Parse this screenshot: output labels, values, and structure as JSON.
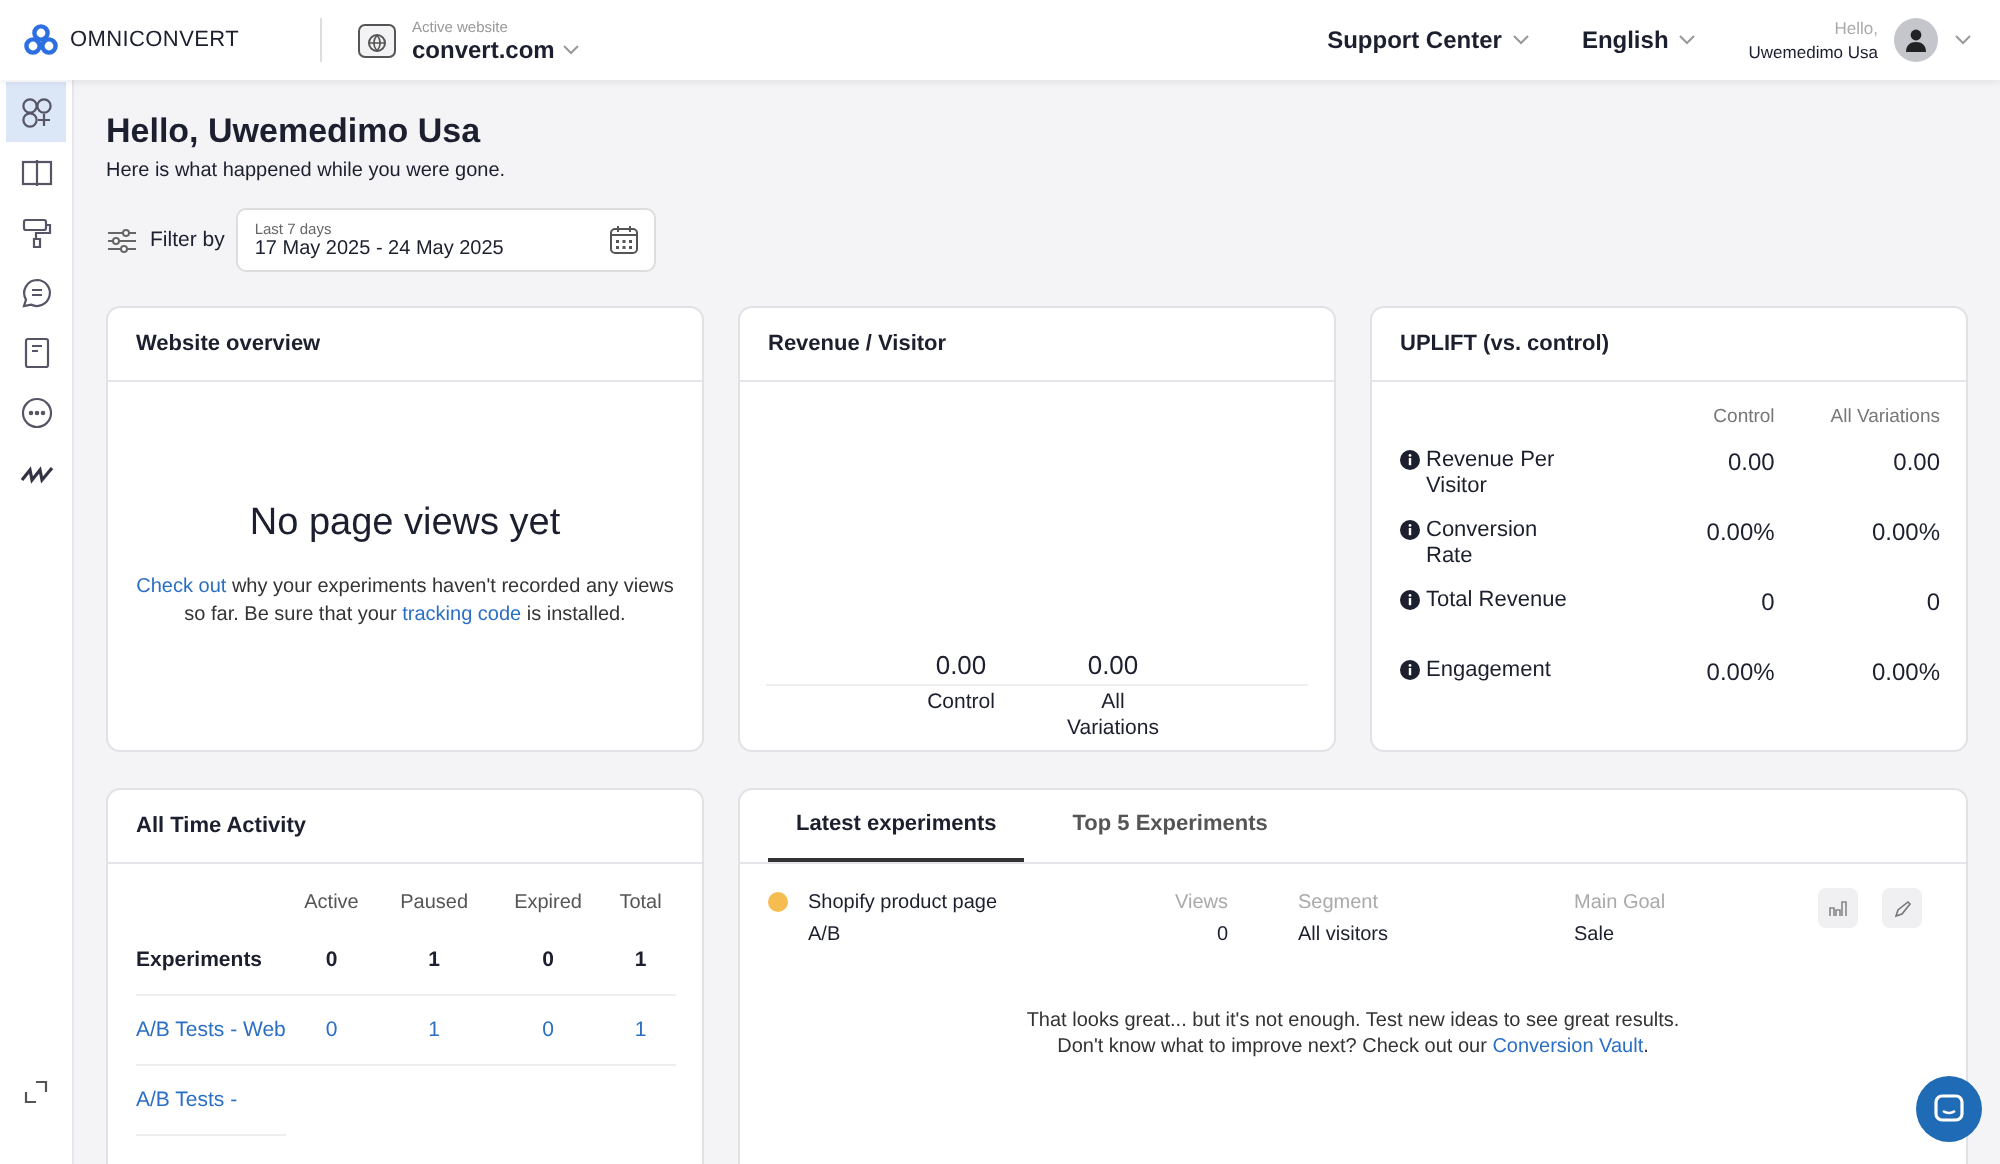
{
  "header": {
    "brand": "OMNICONVERT",
    "website_label": "Active website",
    "website": "convert.com",
    "support": "Support Center",
    "language": "English",
    "greeting": "Hello,",
    "user": "Uwemedimo Usa"
  },
  "sidebar": {
    "items": [
      {
        "kind": "experiences",
        "selected": true
      },
      {
        "kind": "split",
        "selected": false
      },
      {
        "kind": "paint",
        "selected": false
      },
      {
        "kind": "chat",
        "selected": false
      },
      {
        "kind": "document",
        "selected": false
      },
      {
        "kind": "more",
        "selected": false
      },
      {
        "kind": "squiggle",
        "selected": false
      }
    ]
  },
  "page": {
    "title": "Hello, Uwemedimo Usa",
    "subtitle": "Here is what happened while you were gone.",
    "filter_label": "Filter by",
    "range_label": "Last 7 days",
    "range": "17 May 2025 - 24 May 2025"
  },
  "website_overview": {
    "title": "Website overview",
    "empty_title": "No page views yet",
    "message": [
      {
        "kind": "link",
        "text": "Check out"
      },
      {
        "kind": "text",
        "text": " why your experiments haven't recorded any views so far. Be sure that your "
      },
      {
        "kind": "link",
        "text": "tracking code"
      },
      {
        "kind": "text",
        "text": " is installed."
      }
    ]
  },
  "revenue": {
    "title": "Revenue / Visitor",
    "columns": [
      {
        "value": "0.00",
        "label": "Control"
      },
      {
        "value": "0.00",
        "label": "All Variations"
      }
    ]
  },
  "uplift": {
    "title": "UPLIFT (vs. control)",
    "columns": [
      "Control",
      "All Variations"
    ],
    "rows": [
      {
        "label": "Revenue Per Visitor",
        "values": [
          "0.00",
          "0.00"
        ]
      },
      {
        "label": "Conversion Rate",
        "values": [
          "0.00%",
          "0.00%"
        ]
      },
      {
        "label": "Total Revenue",
        "values": [
          "0",
          "0"
        ]
      },
      {
        "label": "Engagement",
        "values": [
          "0.00%",
          "0.00%"
        ]
      }
    ]
  },
  "activity": {
    "title": "All Time Activity",
    "columns": [
      "Active",
      "Paused",
      "Expired",
      "Total"
    ],
    "rows": [
      {
        "label": "Experiments",
        "kind": "total",
        "values": [
          "0",
          "1",
          "0",
          "1"
        ]
      },
      {
        "label": "A/B Tests - Web",
        "kind": "link",
        "values": [
          "0",
          "1",
          "0",
          "1"
        ]
      },
      {
        "label": "A/B Tests -",
        "kind": "link",
        "values": []
      }
    ]
  },
  "experiments": {
    "tabs": [
      {
        "label": "Latest experiments",
        "selected": true
      },
      {
        "label": "Top 5 Experiments",
        "selected": false
      }
    ],
    "items": [
      {
        "name": "Shopify product page",
        "type": "A/B",
        "color": "#f5bd4f",
        "views_label": "Views",
        "views": "0",
        "segment_label": "Segment",
        "segment": "All visitors",
        "goal_label": "Main Goal",
        "goal": "Sale"
      }
    ],
    "message_line1": "That looks great... but it's not enough. Test new ideas to see great results.",
    "message_line2": [
      {
        "kind": "text",
        "text": "Don't know what to improve next? Check out our "
      },
      {
        "kind": "link",
        "text": "Conversion Vault"
      },
      {
        "kind": "text",
        "text": "."
      }
    ]
  }
}
